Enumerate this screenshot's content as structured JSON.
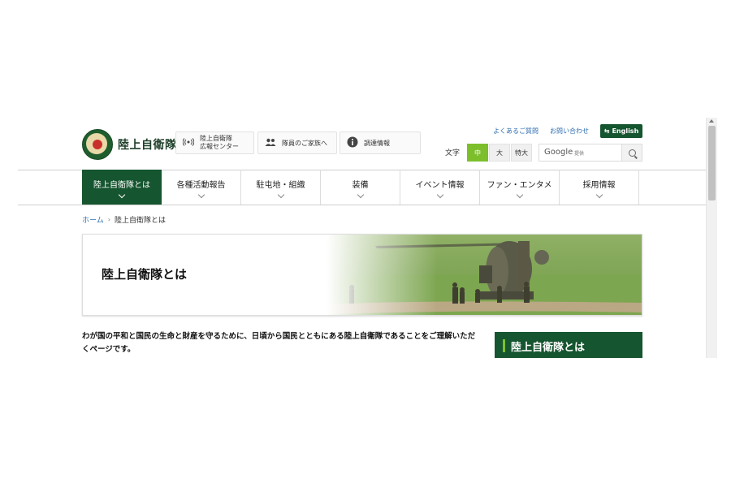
{
  "header": {
    "logo_text": "陸上自衛隊",
    "buttons": [
      {
        "icon": "broadcast-icon",
        "line1": "陸上自衛隊",
        "line2": "広報センター"
      },
      {
        "icon": "people-icon",
        "label": "隊員のご家族へ"
      },
      {
        "icon": "info-icon",
        "label": "調達情報"
      }
    ],
    "links": {
      "faq": "よくあるご質問",
      "contact": "お問い合わせ",
      "english": "English"
    },
    "font_size": {
      "label": "文字",
      "options": [
        "中",
        "大",
        "特大"
      ],
      "selected": "中"
    },
    "search": {
      "brand": "Google",
      "provided": "提供"
    }
  },
  "nav": [
    {
      "label": "陸上自衛隊とは",
      "active": true
    },
    {
      "label": "各種活動報告",
      "active": false
    },
    {
      "label": "駐屯地・組織",
      "active": false
    },
    {
      "label": "装備",
      "active": false
    },
    {
      "label": "イベント情報",
      "active": false
    },
    {
      "label": "ファン・エンタメ",
      "active": false
    },
    {
      "label": "採用情報",
      "active": false
    }
  ],
  "breadcrumb": {
    "home": "ホーム",
    "current": "陸上自衛隊とは"
  },
  "hero": {
    "title": "陸上自衛隊とは"
  },
  "lead": "わが国の平和と国民の生命と財産を守るために、日頃から国民とともにある陸上自衛隊であることをご理解いただくページです。",
  "sidebox": {
    "title": "陸上自衛隊とは"
  },
  "colors": {
    "brand_green": "#15552f",
    "accent_lime": "#7cbf2b",
    "link_blue": "#2e6db0"
  }
}
